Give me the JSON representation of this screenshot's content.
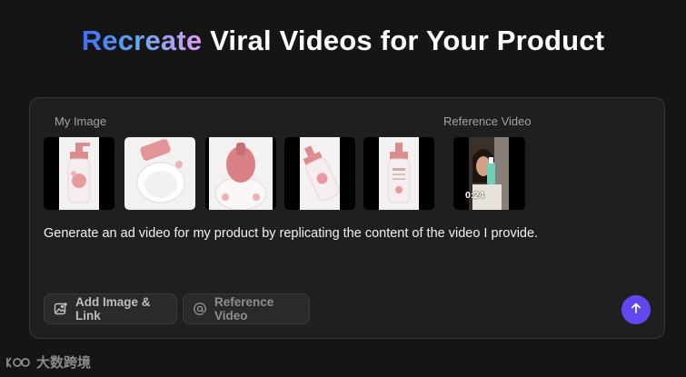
{
  "headline": {
    "accent": "Recreate",
    "rest": " Viral Videos for Your Product"
  },
  "panel": {
    "my_image_label": "My Image",
    "reference_video_label": "Reference Video",
    "product_images": [
      {
        "subject": "pump bottle front"
      },
      {
        "subject": "bottle lying flat"
      },
      {
        "subject": "pump cap close-up"
      },
      {
        "subject": "bottle angled"
      },
      {
        "subject": "bottle back label"
      }
    ],
    "reference_video": {
      "duration": "0:24"
    },
    "prompt_text": "Generate an ad video for my product by replicating the content of the video I provide.",
    "buttons": {
      "add_image": "Add Image & Link",
      "reference_video": "Reference Video"
    },
    "icons": {
      "add_image": "image-plus-icon",
      "reference_video": "at-sign-icon",
      "send": "arrow-up-icon"
    }
  },
  "watermark": {
    "text": "大数跨境"
  },
  "colors": {
    "background": "#151515",
    "panel": "#1f1f1f",
    "send_button": "#6048f0",
    "gradient_start": "#3f6cf5",
    "gradient_end": "#e39cf0"
  }
}
